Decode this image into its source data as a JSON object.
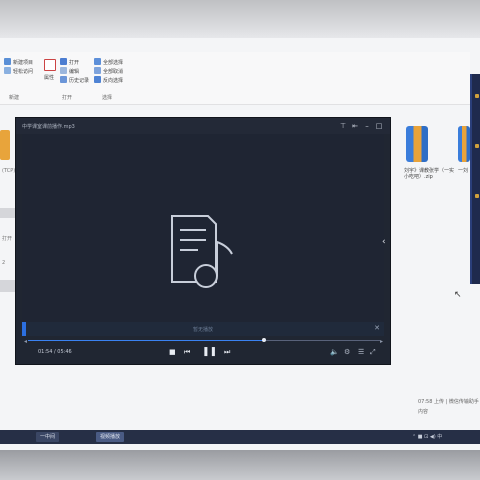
{
  "ribbon": {
    "new_item": "新建项目",
    "easy_access": "轻松访问",
    "properties": "属性",
    "open": "打开",
    "edit": "编辑",
    "history": "历史记录",
    "select_all": "全部选择",
    "select_none": "全部取消",
    "invert": "反向选择",
    "group_new": "新建",
    "group_open": "打开",
    "group_select": "选择"
  },
  "left_labels": [
    "(TCP)",
    "打开",
    "2"
  ],
  "right_files": [
    {
      "caption": "刘宇》课教张学（一实 小吃吧）.zip"
    },
    {
      "caption": "一刘"
    }
  ],
  "player": {
    "title": "中学课室课前播作.mp3",
    "strip_text": "暂无播放",
    "time": "01:54 / 05:46",
    "progress": 0.67,
    "icons": {
      "stop": "stop-icon",
      "prev": "previous-icon",
      "pause": "pause-icon",
      "next": "next-icon",
      "volume": "volume-icon",
      "settings": "settings-icon",
      "playlist": "playlist-icon",
      "fullscreen": "fullscreen-icon"
    }
  },
  "desktop_info": {
    "line1": "07:58 上传 | 微信传输助手",
    "line2": "内容"
  },
  "taskbar": {
    "item1": "一中间",
    "item2": "视频播放",
    "tray_text": "⌃ ■ ⊡ ◀) 中"
  }
}
